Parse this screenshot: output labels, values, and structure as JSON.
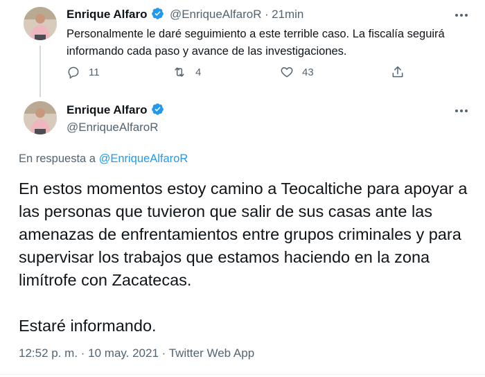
{
  "reply_tweet": {
    "author_name": "Enrique Alfaro",
    "author_handle": "@EnriqueAlfaroR",
    "separator": "·",
    "time": "21min",
    "text": "Personalmente le daré seguimiento a este terrible caso. La fiscalía seguirá informando cada paso y avance de las investigaciones.",
    "actions": {
      "replies": "11",
      "retweets": "4",
      "likes": "43"
    }
  },
  "main_tweet": {
    "author_name": "Enrique Alfaro",
    "author_handle": "@EnriqueAlfaroR",
    "in_reply_prefix": "En respuesta a",
    "in_reply_mention": "@EnriqueAlfaroR",
    "paragraph_1": "En estos momentos estoy camino a Teocaltiche para apoyar a las personas que tuvieron que salir de sus casas ante las amenazas de enfrentamientos entre grupos criminales y para supervisar los trabajos que estamos haciendo en la zona limítrofe con Zacatecas.",
    "paragraph_2": "Estaré informando.",
    "timestamp": "12:52 p. m. · 10 may. 2021 · Twitter Web App"
  },
  "colors": {
    "accent": "#1d9bf0",
    "secondary_text": "#536471",
    "primary_text": "#0f1419"
  },
  "icons": {
    "verified": "verified-badge-icon",
    "more": "more-horizontal-icon",
    "reply": "reply-icon",
    "retweet": "retweet-icon",
    "like": "heart-icon",
    "share": "share-icon"
  }
}
